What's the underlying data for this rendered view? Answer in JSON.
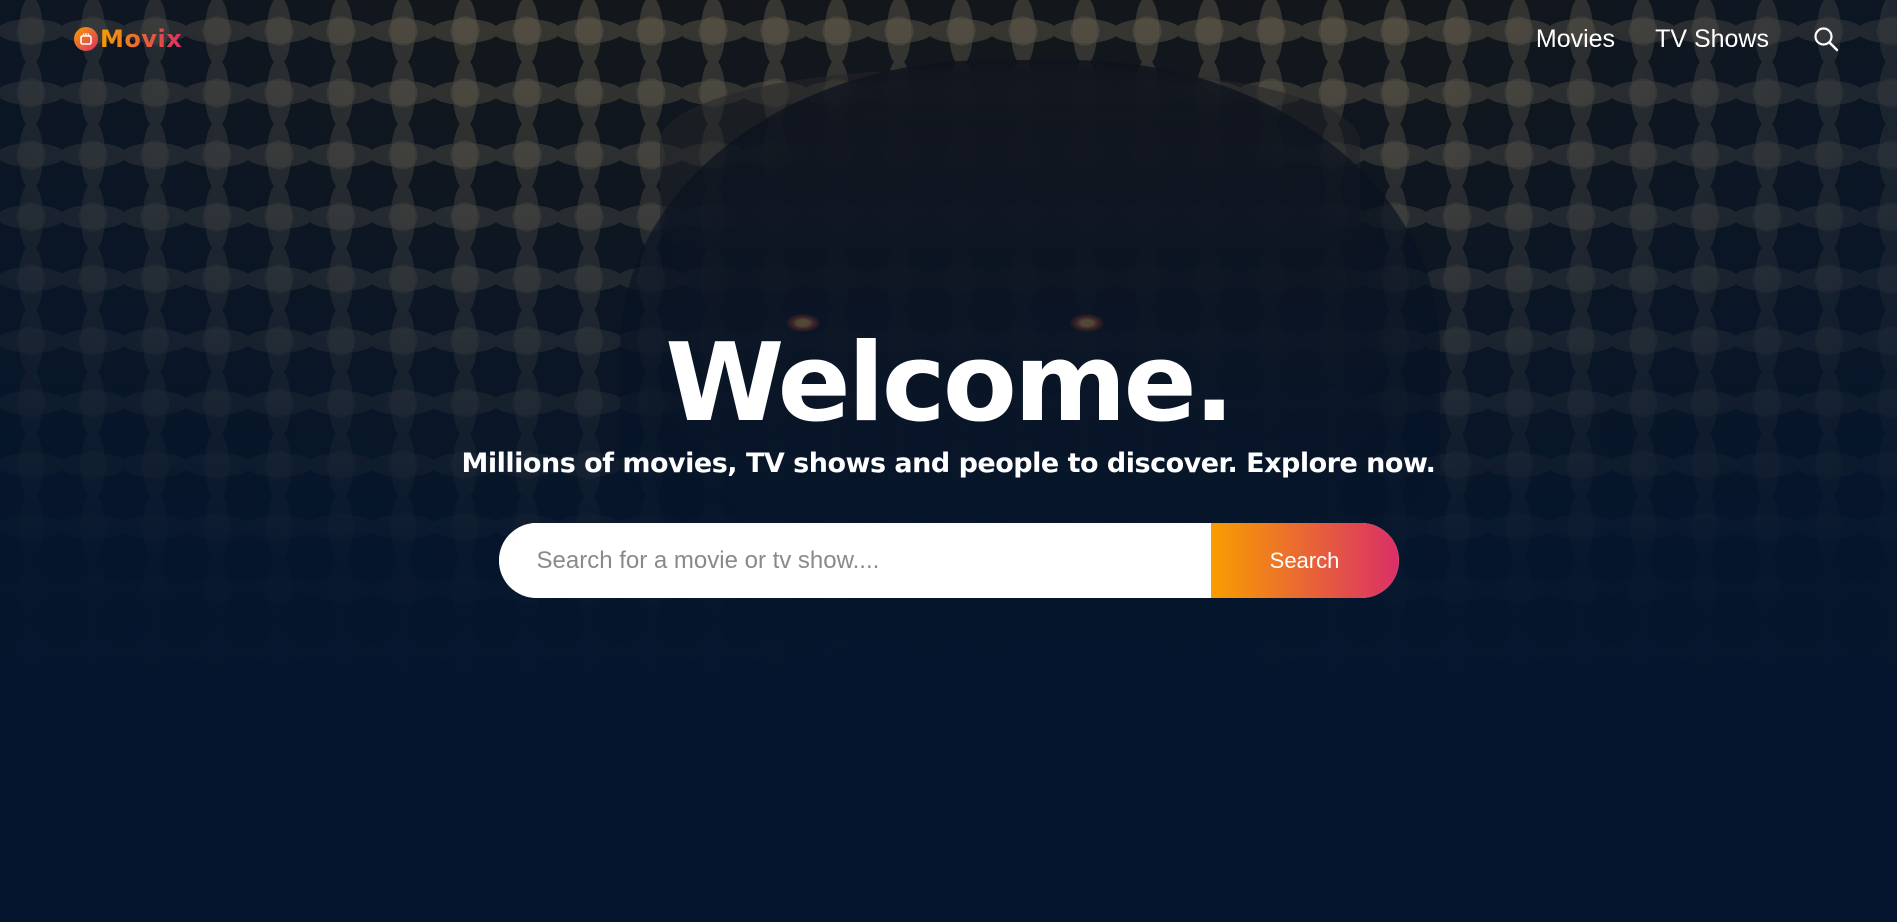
{
  "header": {
    "logo_text": "Movix",
    "nav": {
      "movies": "Movies",
      "tv_shows": "TV Shows"
    },
    "search_icon": "search-icon"
  },
  "hero": {
    "title": "Welcome.",
    "subtitle": "Millions of movies, TV shows and people to discover. Explore now.",
    "search": {
      "placeholder": "Search for a movie or tv show....",
      "value": "",
      "button_label": "Search"
    }
  },
  "colors": {
    "background": "#04152d",
    "gradient_start": "#f89e00",
    "gradient_end": "#da2f68"
  }
}
